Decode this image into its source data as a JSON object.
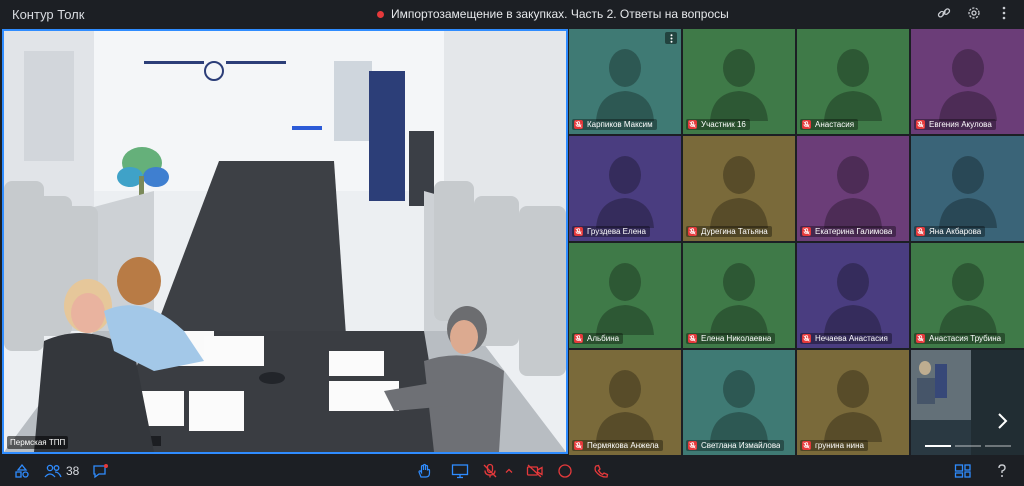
{
  "app": {
    "title": "Контур Толк"
  },
  "meeting": {
    "title": "Импортозамещение в закупках. Часть 2. Ответы на вопросы",
    "recording": true
  },
  "colors": {
    "accent": "#2f8cff",
    "record": "#e5393b",
    "mic_off": "#e5393b"
  },
  "main_video": {
    "speaker_label": "Пермская ТПП"
  },
  "participants": [
    {
      "name": "Карпиков Максим",
      "color": "#3f7a74"
    },
    {
      "name": "Участник 16",
      "color": "#3f7a48"
    },
    {
      "name": "Анастасия",
      "color": "#3f7a48"
    },
    {
      "name": "Евгения Акулова",
      "color": "#6b3d78"
    },
    {
      "name": "Груздева Елена",
      "color": "#4a3d80"
    },
    {
      "name": "Дурегина Татьяна",
      "color": "#7a6a3a"
    },
    {
      "name": "Екатерина Галимова",
      "color": "#6b3d78"
    },
    {
      "name": "Яна Акбарова",
      "color": "#3a6478"
    },
    {
      "name": "Альбина",
      "color": "#3f7a48"
    },
    {
      "name": "Елена Николаевна",
      "color": "#3f7a48"
    },
    {
      "name": "Нечаева Анастасия",
      "color": "#4a3d80"
    },
    {
      "name": "Анастасия Трубина",
      "color": "#3f7a48"
    },
    {
      "name": "Пермякова Анжела",
      "color": "#7a6a3a"
    },
    {
      "name": "Светлана Измайлова",
      "color": "#3f7a74"
    },
    {
      "name": "грунина нина",
      "color": "#7a6a3a"
    }
  ],
  "toolbar": {
    "participants_count": "38"
  }
}
